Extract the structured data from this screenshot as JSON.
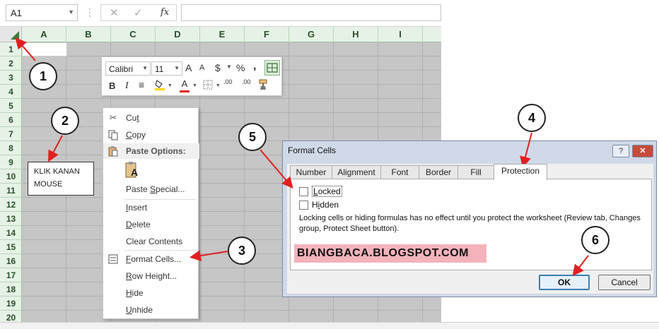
{
  "formula_bar": {
    "name_box": "A1",
    "cancel_glyph": "✕",
    "enter_glyph": "✓",
    "fx_label": "fx"
  },
  "columns": [
    "A",
    "B",
    "C",
    "D",
    "E",
    "F",
    "G",
    "H",
    "I"
  ],
  "rows": [
    "1",
    "2",
    "3",
    "4",
    "5",
    "6",
    "7",
    "8",
    "9",
    "10",
    "11",
    "12",
    "13",
    "14",
    "15",
    "16",
    "17",
    "18",
    "19",
    "20"
  ],
  "mini_toolbar": {
    "font": "Calibri",
    "size": "11",
    "grow_font": "A",
    "shrink_font": "A",
    "currency": "$",
    "percent": "%",
    "comma": ",",
    "bold": "B",
    "italic": "I",
    "font_color": "A",
    "increase_decimal": ".00",
    "decrease_decimal": ".00"
  },
  "context_menu": {
    "cut": "Cut",
    "copy": "Copy",
    "paste_options": "Paste Options:",
    "paste_icon_letter": "A",
    "paste_special": "Paste Special...",
    "insert": "Insert",
    "delete": "Delete",
    "clear_contents": "Clear Contents",
    "format_cells": "Format Cells...",
    "row_height": "Row Height...",
    "hide": "Hide",
    "unhide": "Unhide"
  },
  "klik_box": {
    "line1": "KLIK KANAN",
    "line2": "MOUSE"
  },
  "dialog": {
    "title": "Format Cells",
    "help": "?",
    "close": "✕",
    "tabs": [
      "Number",
      "Alignment",
      "Font",
      "Border",
      "Fill",
      "Protection"
    ],
    "active_tab": "Protection",
    "locked_label": "Locked",
    "hidden_label": "Hidden",
    "note": "Locking cells or hiding formulas has no effect until you protect the worksheet (Review tab, Changes group, Protect Sheet button).",
    "ok_label": "OK",
    "cancel_label": "Cancel"
  },
  "watermark": "BIANGBACA.BLOGSPOT.COM",
  "badges": [
    "1",
    "2",
    "3",
    "4",
    "5",
    "6"
  ],
  "colors": {
    "sheet_gray": "#c6c6c6",
    "header_green": "#e6f2e6",
    "dialog_frame": "#cfd9e8",
    "close_red": "#c74a3a",
    "watermark_pink": "#f4b3bb",
    "arrow_red": "#e02020"
  }
}
